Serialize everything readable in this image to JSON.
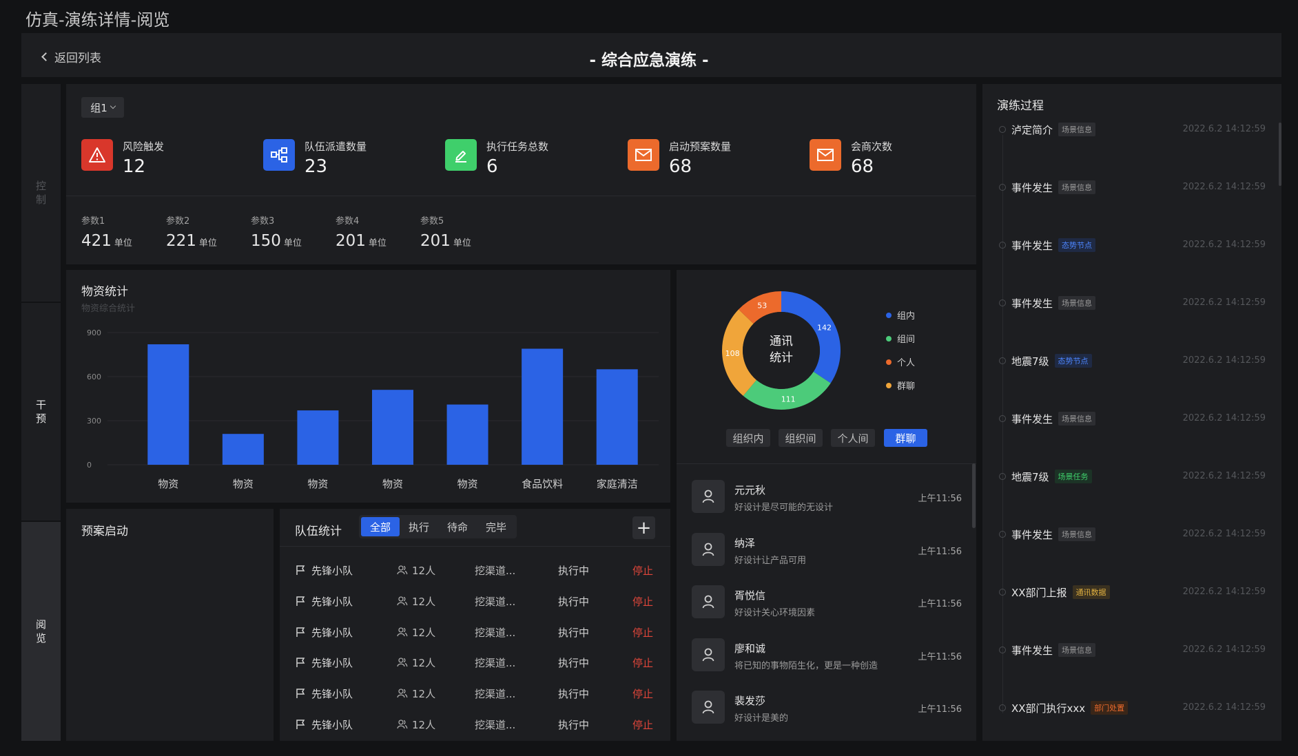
{
  "page_title": "仿真-演练详情-阅览",
  "header": {
    "back_label": "返回列表",
    "title": "-  综合应急演练  -"
  },
  "rail": [
    {
      "label": "控\n制"
    },
    {
      "label": "干\n预"
    },
    {
      "label": "阅\n览"
    }
  ],
  "group_select": {
    "value": "组1"
  },
  "kpis": [
    {
      "label": "风险触发",
      "value": "12",
      "color": "#d9372b",
      "icon": "warning-icon"
    },
    {
      "label": "队伍派遣数量",
      "value": "23",
      "color": "#2b63e5",
      "icon": "network-icon"
    },
    {
      "label": "执行任务总数",
      "value": "6",
      "color": "#3fcf6b",
      "icon": "edit-icon"
    },
    {
      "label": "启动预案数量",
      "value": "68",
      "color": "#ec6a2c",
      "icon": "mail-icon"
    },
    {
      "label": "会商次数",
      "value": "68",
      "color": "#ec6a2c",
      "icon": "mail-icon"
    }
  ],
  "params": [
    {
      "label": "参数1",
      "value": "421",
      "unit": "单位"
    },
    {
      "label": "参数2",
      "value": "221",
      "unit": "单位"
    },
    {
      "label": "参数3",
      "value": "150",
      "unit": "单位"
    },
    {
      "label": "参数4",
      "value": "201",
      "unit": "单位"
    },
    {
      "label": "参数5",
      "value": "201",
      "unit": "单位"
    }
  ],
  "supplies": {
    "title": "物资统计",
    "subtitle": "物资综合统计"
  },
  "chart_data": [
    {
      "type": "bar",
      "title": "物资统计",
      "subtitle": "物资综合统计",
      "categories": [
        "物资",
        "物资",
        "物资",
        "物资",
        "物资",
        "食品饮料",
        "家庭清洁"
      ],
      "values": [
        820,
        210,
        370,
        510,
        410,
        790,
        650
      ],
      "yticks": [
        0,
        300,
        600,
        900
      ],
      "ylim": [
        0,
        900
      ],
      "color": "#2b63e5"
    },
    {
      "type": "pie",
      "title": "通讯统计",
      "labels": [
        "组内",
        "组间",
        "个人",
        "群聊"
      ],
      "values": [
        142,
        111,
        53,
        108
      ],
      "colors": [
        "#2b63e5",
        "#4ccb7a",
        "#ec6a2c",
        "#f0a53a"
      ],
      "legend": "right"
    }
  ],
  "comm": {
    "center_line1": "通讯",
    "center_line2": "统计",
    "filters": [
      {
        "label": "组织内",
        "active": false
      },
      {
        "label": "组织间",
        "active": false
      },
      {
        "label": "个人间",
        "active": false
      },
      {
        "label": "群聊",
        "active": true
      }
    ],
    "messages": [
      {
        "name": "元元秋",
        "text": "好设计是尽可能的无设计",
        "time": "上午11:56"
      },
      {
        "name": "纳泽",
        "text": "好设计让产品可用",
        "time": "上午11:56"
      },
      {
        "name": "胥悦信",
        "text": "好设计关心环境因素",
        "time": "上午11:56"
      },
      {
        "name": "廖和诚",
        "text": "将已知的事物陌生化，更是一种创造",
        "time": "上午11:56"
      },
      {
        "name": "裴发莎",
        "text": "好设计是美的",
        "time": "上午11:56"
      }
    ]
  },
  "plan": {
    "title": "预案启动"
  },
  "teams": {
    "title": "队伍统计",
    "tabs": [
      {
        "label": "全部",
        "active": true
      },
      {
        "label": "执行",
        "active": false
      },
      {
        "label": "待命",
        "active": false
      },
      {
        "label": "完毕",
        "active": false
      }
    ],
    "add_label": "+",
    "rows": [
      {
        "name": "先锋小队",
        "people": "12人",
        "task": "挖渠道...",
        "status": "执行中",
        "action": "停止"
      },
      {
        "name": "先锋小队",
        "people": "12人",
        "task": "挖渠道...",
        "status": "执行中",
        "action": "停止"
      },
      {
        "name": "先锋小队",
        "people": "12人",
        "task": "挖渠道...",
        "status": "执行中",
        "action": "停止"
      },
      {
        "name": "先锋小队",
        "people": "12人",
        "task": "挖渠道...",
        "status": "执行中",
        "action": "停止"
      },
      {
        "name": "先锋小队",
        "people": "12人",
        "task": "挖渠道...",
        "status": "执行中",
        "action": "停止"
      },
      {
        "name": "先锋小队",
        "people": "12人",
        "task": "挖渠道...",
        "status": "执行中",
        "action": "停止"
      }
    ]
  },
  "timeline": {
    "title": "演练过程",
    "items": [
      {
        "title": "泸定简介",
        "tag": "场景信息",
        "tag_color": "#9a9a9a",
        "tag_bg": "#2d2e32",
        "time": "2022.6.2 14:12:59"
      },
      {
        "title": "事件发生",
        "tag": "场景信息",
        "tag_color": "#9a9a9a",
        "tag_bg": "#2d2e32",
        "time": "2022.6.2 14:12:59"
      },
      {
        "title": "事件发生",
        "tag": "态势节点",
        "tag_color": "#4d86ff",
        "tag_bg": "#1f2a44",
        "time": "2022.6.2 14:12:59"
      },
      {
        "title": "事件发生",
        "tag": "场景信息",
        "tag_color": "#9a9a9a",
        "tag_bg": "#2d2e32",
        "time": "2022.6.2 14:12:59"
      },
      {
        "title": "地震7级",
        "tag": "态势节点",
        "tag_color": "#4d86ff",
        "tag_bg": "#1f2a44",
        "time": "2022.6.2 14:12:59"
      },
      {
        "title": "事件发生",
        "tag": "场景信息",
        "tag_color": "#9a9a9a",
        "tag_bg": "#2d2e32",
        "time": "2022.6.2 14:12:59"
      },
      {
        "title": "地震7级",
        "tag": "场景任务",
        "tag_color": "#3fcf6b",
        "tag_bg": "#1c3326",
        "time": "2022.6.2 14:12:59"
      },
      {
        "title": "事件发生",
        "tag": "场景信息",
        "tag_color": "#9a9a9a",
        "tag_bg": "#2d2e32",
        "time": "2022.6.2 14:12:59"
      },
      {
        "title": "XX部门上报",
        "tag": "通讯数据",
        "tag_color": "#e0b040",
        "tag_bg": "#3a3120",
        "time": "2022.6.2 14:12:59"
      },
      {
        "title": "事件发生",
        "tag": "场景信息",
        "tag_color": "#9a9a9a",
        "tag_bg": "#2d2e32",
        "time": "2022.6.2 14:12:59"
      },
      {
        "title": "XX部门执行xxx",
        "tag": "部门处置",
        "tag_color": "#ec6a2c",
        "tag_bg": "#3a2618",
        "time": "2022.6.2 14:12:59"
      }
    ]
  }
}
